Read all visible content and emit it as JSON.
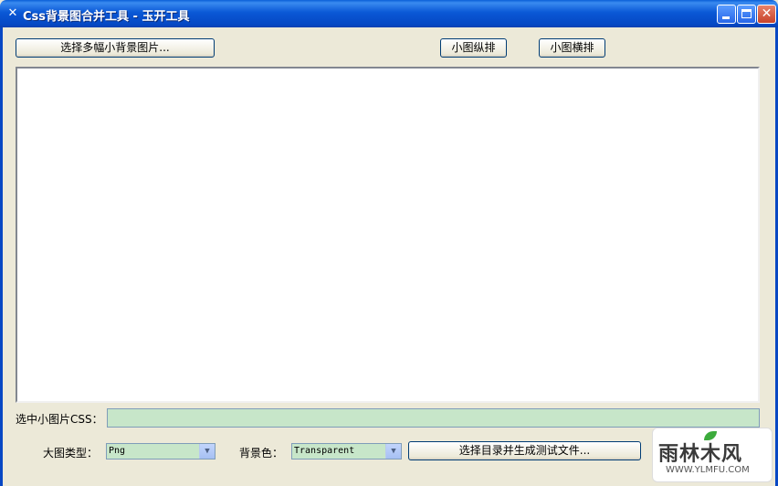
{
  "window": {
    "title": "Css背景图合并工具 - 玉开工具",
    "app_icon": "tools-icon",
    "controls": [
      "minimize-icon",
      "maximize-icon",
      "close-icon"
    ]
  },
  "toolbar": {
    "select_images_label": "选择多幅小背景图片...",
    "vertical_label": "小图纵排",
    "horizontal_label": "小图横排"
  },
  "css_field": {
    "label": "选中小图片CSS：",
    "value": ""
  },
  "bottom": {
    "big_image_type_label": "大图类型：",
    "big_image_type_value": "Png",
    "bg_color_label": "背景色：",
    "bg_color_value": "Transparent",
    "generate_label": "选择目录并生成测试文件..."
  },
  "watermark": {
    "main": "雨林木风",
    "url": "WWW.YLMFU.COM"
  },
  "colors": {
    "titlebar": "#0a58d6",
    "field_bg": "#c7e6c9",
    "window_bg": "#ece9d8"
  }
}
